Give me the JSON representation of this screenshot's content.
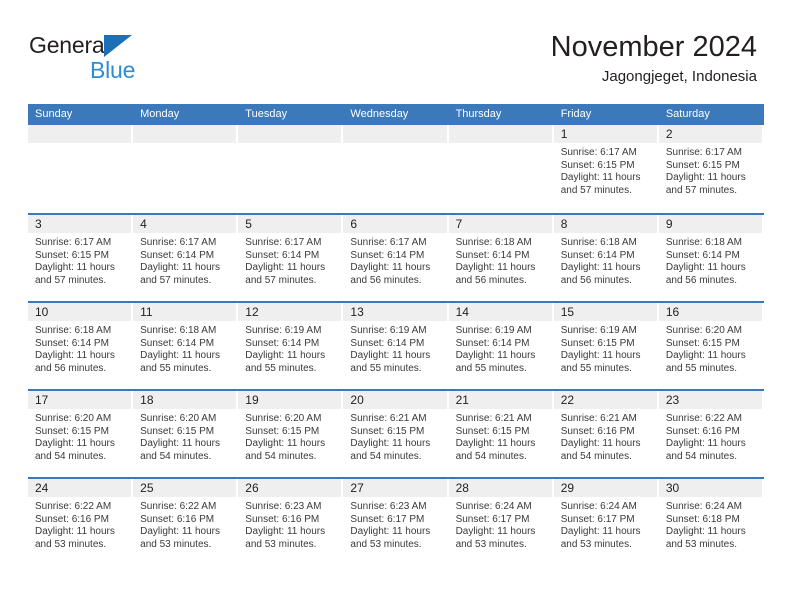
{
  "brand": {
    "line1": "General",
    "line2": "Blue",
    "triangle_color": "#1d6fb8",
    "blue_text_color": "#2e8bd6"
  },
  "header": {
    "title": "November 2024",
    "location": "Jagongjeget, Indonesia"
  },
  "colors": {
    "header_blue": "#3b79ba",
    "daynum_band": "#efefef",
    "text": "#231f20"
  },
  "weekdays": [
    "Sunday",
    "Monday",
    "Tuesday",
    "Wednesday",
    "Thursday",
    "Friday",
    "Saturday"
  ],
  "weeks": [
    [
      {
        "day": "",
        "empty": true
      },
      {
        "day": "",
        "empty": true
      },
      {
        "day": "",
        "empty": true
      },
      {
        "day": "",
        "empty": true
      },
      {
        "day": "",
        "empty": true
      },
      {
        "day": "1",
        "sunrise": "Sunrise: 6:17 AM",
        "sunset": "Sunset: 6:15 PM",
        "daylight_1": "Daylight: 11 hours",
        "daylight_2": "and 57 minutes."
      },
      {
        "day": "2",
        "sunrise": "Sunrise: 6:17 AM",
        "sunset": "Sunset: 6:15 PM",
        "daylight_1": "Daylight: 11 hours",
        "daylight_2": "and 57 minutes."
      }
    ],
    [
      {
        "day": "3",
        "sunrise": "Sunrise: 6:17 AM",
        "sunset": "Sunset: 6:15 PM",
        "daylight_1": "Daylight: 11 hours",
        "daylight_2": "and 57 minutes."
      },
      {
        "day": "4",
        "sunrise": "Sunrise: 6:17 AM",
        "sunset": "Sunset: 6:14 PM",
        "daylight_1": "Daylight: 11 hours",
        "daylight_2": "and 57 minutes."
      },
      {
        "day": "5",
        "sunrise": "Sunrise: 6:17 AM",
        "sunset": "Sunset: 6:14 PM",
        "daylight_1": "Daylight: 11 hours",
        "daylight_2": "and 57 minutes."
      },
      {
        "day": "6",
        "sunrise": "Sunrise: 6:17 AM",
        "sunset": "Sunset: 6:14 PM",
        "daylight_1": "Daylight: 11 hours",
        "daylight_2": "and 56 minutes."
      },
      {
        "day": "7",
        "sunrise": "Sunrise: 6:18 AM",
        "sunset": "Sunset: 6:14 PM",
        "daylight_1": "Daylight: 11 hours",
        "daylight_2": "and 56 minutes."
      },
      {
        "day": "8",
        "sunrise": "Sunrise: 6:18 AM",
        "sunset": "Sunset: 6:14 PM",
        "daylight_1": "Daylight: 11 hours",
        "daylight_2": "and 56 minutes."
      },
      {
        "day": "9",
        "sunrise": "Sunrise: 6:18 AM",
        "sunset": "Sunset: 6:14 PM",
        "daylight_1": "Daylight: 11 hours",
        "daylight_2": "and 56 minutes."
      }
    ],
    [
      {
        "day": "10",
        "sunrise": "Sunrise: 6:18 AM",
        "sunset": "Sunset: 6:14 PM",
        "daylight_1": "Daylight: 11 hours",
        "daylight_2": "and 56 minutes."
      },
      {
        "day": "11",
        "sunrise": "Sunrise: 6:18 AM",
        "sunset": "Sunset: 6:14 PM",
        "daylight_1": "Daylight: 11 hours",
        "daylight_2": "and 55 minutes."
      },
      {
        "day": "12",
        "sunrise": "Sunrise: 6:19 AM",
        "sunset": "Sunset: 6:14 PM",
        "daylight_1": "Daylight: 11 hours",
        "daylight_2": "and 55 minutes."
      },
      {
        "day": "13",
        "sunrise": "Sunrise: 6:19 AM",
        "sunset": "Sunset: 6:14 PM",
        "daylight_1": "Daylight: 11 hours",
        "daylight_2": "and 55 minutes."
      },
      {
        "day": "14",
        "sunrise": "Sunrise: 6:19 AM",
        "sunset": "Sunset: 6:14 PM",
        "daylight_1": "Daylight: 11 hours",
        "daylight_2": "and 55 minutes."
      },
      {
        "day": "15",
        "sunrise": "Sunrise: 6:19 AM",
        "sunset": "Sunset: 6:15 PM",
        "daylight_1": "Daylight: 11 hours",
        "daylight_2": "and 55 minutes."
      },
      {
        "day": "16",
        "sunrise": "Sunrise: 6:20 AM",
        "sunset": "Sunset: 6:15 PM",
        "daylight_1": "Daylight: 11 hours",
        "daylight_2": "and 55 minutes."
      }
    ],
    [
      {
        "day": "17",
        "sunrise": "Sunrise: 6:20 AM",
        "sunset": "Sunset: 6:15 PM",
        "daylight_1": "Daylight: 11 hours",
        "daylight_2": "and 54 minutes."
      },
      {
        "day": "18",
        "sunrise": "Sunrise: 6:20 AM",
        "sunset": "Sunset: 6:15 PM",
        "daylight_1": "Daylight: 11 hours",
        "daylight_2": "and 54 minutes."
      },
      {
        "day": "19",
        "sunrise": "Sunrise: 6:20 AM",
        "sunset": "Sunset: 6:15 PM",
        "daylight_1": "Daylight: 11 hours",
        "daylight_2": "and 54 minutes."
      },
      {
        "day": "20",
        "sunrise": "Sunrise: 6:21 AM",
        "sunset": "Sunset: 6:15 PM",
        "daylight_1": "Daylight: 11 hours",
        "daylight_2": "and 54 minutes."
      },
      {
        "day": "21",
        "sunrise": "Sunrise: 6:21 AM",
        "sunset": "Sunset: 6:15 PM",
        "daylight_1": "Daylight: 11 hours",
        "daylight_2": "and 54 minutes."
      },
      {
        "day": "22",
        "sunrise": "Sunrise: 6:21 AM",
        "sunset": "Sunset: 6:16 PM",
        "daylight_1": "Daylight: 11 hours",
        "daylight_2": "and 54 minutes."
      },
      {
        "day": "23",
        "sunrise": "Sunrise: 6:22 AM",
        "sunset": "Sunset: 6:16 PM",
        "daylight_1": "Daylight: 11 hours",
        "daylight_2": "and 54 minutes."
      }
    ],
    [
      {
        "day": "24",
        "sunrise": "Sunrise: 6:22 AM",
        "sunset": "Sunset: 6:16 PM",
        "daylight_1": "Daylight: 11 hours",
        "daylight_2": "and 53 minutes."
      },
      {
        "day": "25",
        "sunrise": "Sunrise: 6:22 AM",
        "sunset": "Sunset: 6:16 PM",
        "daylight_1": "Daylight: 11 hours",
        "daylight_2": "and 53 minutes."
      },
      {
        "day": "26",
        "sunrise": "Sunrise: 6:23 AM",
        "sunset": "Sunset: 6:16 PM",
        "daylight_1": "Daylight: 11 hours",
        "daylight_2": "and 53 minutes."
      },
      {
        "day": "27",
        "sunrise": "Sunrise: 6:23 AM",
        "sunset": "Sunset: 6:17 PM",
        "daylight_1": "Daylight: 11 hours",
        "daylight_2": "and 53 minutes."
      },
      {
        "day": "28",
        "sunrise": "Sunrise: 6:24 AM",
        "sunset": "Sunset: 6:17 PM",
        "daylight_1": "Daylight: 11 hours",
        "daylight_2": "and 53 minutes."
      },
      {
        "day": "29",
        "sunrise": "Sunrise: 6:24 AM",
        "sunset": "Sunset: 6:17 PM",
        "daylight_1": "Daylight: 11 hours",
        "daylight_2": "and 53 minutes."
      },
      {
        "day": "30",
        "sunrise": "Sunrise: 6:24 AM",
        "sunset": "Sunset: 6:18 PM",
        "daylight_1": "Daylight: 11 hours",
        "daylight_2": "and 53 minutes."
      }
    ]
  ]
}
